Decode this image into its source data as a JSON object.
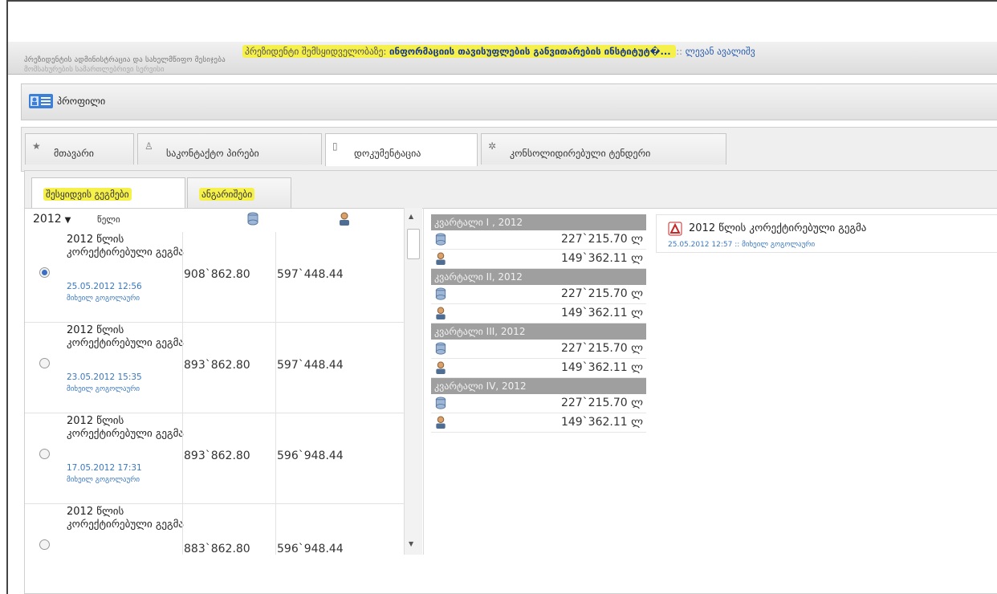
{
  "banner": {
    "org_line1": "პრეზიდენტის ადმინისტრაცია და სახელმწიფო მესიჯება",
    "org_line2": "მომსახურების სამართლებრივი სერვისი",
    "prefix": "პრეზიდენტი შემსყიდველობაზე:",
    "organization": "ინფორმაციის თავისუფლების განვითარების ინსტიტუტ�...",
    "separator": "::",
    "user": "ლევან ავალიშვ"
  },
  "profile": {
    "label": "პროფილი"
  },
  "tabs": [
    {
      "label": "მთავარი",
      "icon": "star-icon"
    },
    {
      "label": "საკონტაქტო პირები",
      "icon": "person-icon"
    },
    {
      "label": "დოკუმენტაცია",
      "icon": "document-icon"
    },
    {
      "label": "კონსოლიდირებული ტენდერი",
      "icon": "gear-icon"
    }
  ],
  "subtabs": [
    {
      "label": "შესყიდვის გეგმები"
    },
    {
      "label": "ანგარიშები"
    }
  ],
  "plans": {
    "year": "2012",
    "year_label": "წელი",
    "rows": [
      {
        "title": "2012 წლის კორექტირებული გეგმა",
        "date": "25.05.2012 12:56",
        "user": "მიხეილ გოგოლაური",
        "v1": "908`862.80",
        "v2": "597`448.44",
        "selected": true
      },
      {
        "title": "2012 წლის კორექტირებული გეგმა",
        "date": "23.05.2012 15:35",
        "user": "მიხეილ გოგოლაური",
        "v1": "893`862.80",
        "v2": "597`448.44",
        "selected": false
      },
      {
        "title": "2012 წლის კორექტირებული გეგმა",
        "date": "17.05.2012 17:31",
        "user": "მიხეილ გოგოლაური",
        "v1": "893`862.80",
        "v2": "596`948.44",
        "selected": false
      },
      {
        "title": "2012 წლის კორექტირებული გეგმა",
        "date": "",
        "user": "",
        "v1": "883`862.80",
        "v2": "596`948.44",
        "selected": false
      }
    ]
  },
  "quarters": [
    {
      "label": "კვარტალი I , 2012",
      "v1": "227`215.70 ლ",
      "v2": "149`362.11 ლ"
    },
    {
      "label": "კვარტალი II, 2012",
      "v1": "227`215.70 ლ",
      "v2": "149`362.11 ლ"
    },
    {
      "label": "კვარტალი III, 2012",
      "v1": "227`215.70 ლ",
      "v2": "149`362.11 ლ"
    },
    {
      "label": "კვარტალი IV, 2012",
      "v1": "227`215.70 ლ",
      "v2": "149`362.11 ლ"
    }
  ],
  "document": {
    "title": "2012 წლის კორექტირებული გეგმა",
    "meta": "25.05.2012 12:57 :: მიხეილ გოგოლაური"
  },
  "colors": {
    "highlight": "#f5f04a",
    "link": "#3a78c0",
    "quarter_header": "#9f9f9f"
  }
}
